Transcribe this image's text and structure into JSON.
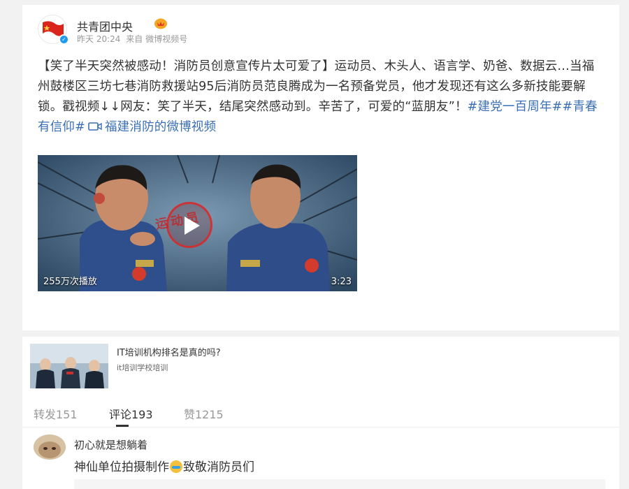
{
  "post": {
    "user_name": "共青团中央",
    "time": "昨天 20:24",
    "source_prefix": "来自",
    "source": "微博视频号",
    "title_text": "【笑了半天突然被感动！消防员创意宣传片太可爱了】运动员、木头人、语言学、奶爸、数据云…当福州鼓楼区三坊七巷消防救援站95后消防员范良腾成为一名预备党员，他才发现还有这么多新技能要解锁。戳视频↓↓网友：笑了半天，结尾突然感动到。辛苦了，可爱的“蓝朋友”！",
    "hashtag_1": "#建党一百周年#",
    "hashtag_2": "#青春有信仰#",
    "video_link": "福建消防的微博视频",
    "video": {
      "play_count": "255万次播放",
      "duration": "3:23",
      "stamp": "运动员"
    }
  },
  "ad": {
    "title": "IT培训机构排名是真的吗?",
    "subtitle": "it培训学校培训"
  },
  "tabs": {
    "repost": "转发151",
    "comments": "评论193",
    "likes": "赞1215"
  },
  "comment": {
    "user_name": "初心就是想躺着",
    "text_before": "神仙单位拍摄制作",
    "text_after": "致敬消防员们"
  },
  "colors": {
    "link": "#3a6fb5",
    "verify": "#1e9bf0",
    "background": "#f2f2f2"
  }
}
